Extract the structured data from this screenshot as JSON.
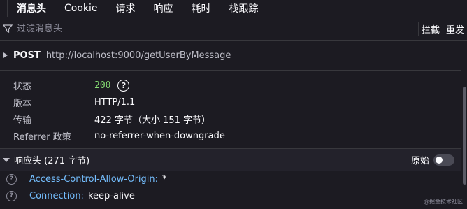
{
  "tabs": {
    "items": [
      {
        "label": "消息头"
      },
      {
        "label": "Cookie"
      },
      {
        "label": "请求"
      },
      {
        "label": "响应"
      },
      {
        "label": "耗时"
      },
      {
        "label": "栈跟踪"
      }
    ],
    "active": "消息头"
  },
  "filter": {
    "placeholder": "过滤消息头",
    "block_label": "拦截",
    "resend_label": "重发"
  },
  "request": {
    "method": "POST",
    "url": "http://localhost:9000/getUserByMessage"
  },
  "summary": {
    "status_label": "状态",
    "status_code": "200",
    "version_label": "版本",
    "version_value": "HTTP/1.1",
    "transfer_label": "传输",
    "transfer_value": "422 字节（大小 151 字节）",
    "referrer_label": "Referrer 政策",
    "referrer_value": "no-referrer-when-downgrade"
  },
  "response_headers": {
    "title": "响应头 (271 字节)",
    "raw_label": "原始",
    "items": [
      {
        "name": "Access-Control-Allow-Origin:",
        "value": "*"
      },
      {
        "name": "Connection:",
        "value": "keep-alive"
      }
    ]
  },
  "watermark": "@掘金技术社区",
  "colors": {
    "background": "#1c1b22",
    "status_ok": "#86de74",
    "header_name": "#75bfff"
  }
}
